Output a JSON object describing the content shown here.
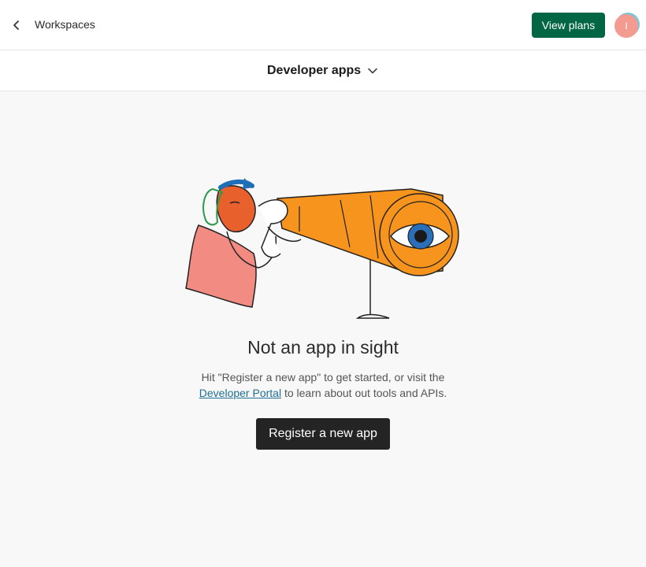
{
  "header": {
    "back_label": "Workspaces",
    "view_plans_label": "View plans",
    "avatar_initial": "I"
  },
  "subheader": {
    "title": "Developer apps"
  },
  "empty_state": {
    "title": "Not an app in sight",
    "desc_part1": "Hit \"Register a new app\" to get started, or visit the",
    "link_text": "Developer Portal",
    "desc_part2": " to learn about out tools and APIs.",
    "button_label": "Register a new app"
  },
  "icons": {
    "back": "chevron-left-icon",
    "dropdown": "chevron-down-icon"
  },
  "colors": {
    "primary_green": "#006644",
    "dark_button": "#242424",
    "link": "#1f6e93",
    "avatar": "#f39b90",
    "telescope_orange": "#f7941d",
    "eye_blue": "#2a6fb8",
    "person_skin": "#e8602c",
    "person_shirt": "#f28b82"
  }
}
